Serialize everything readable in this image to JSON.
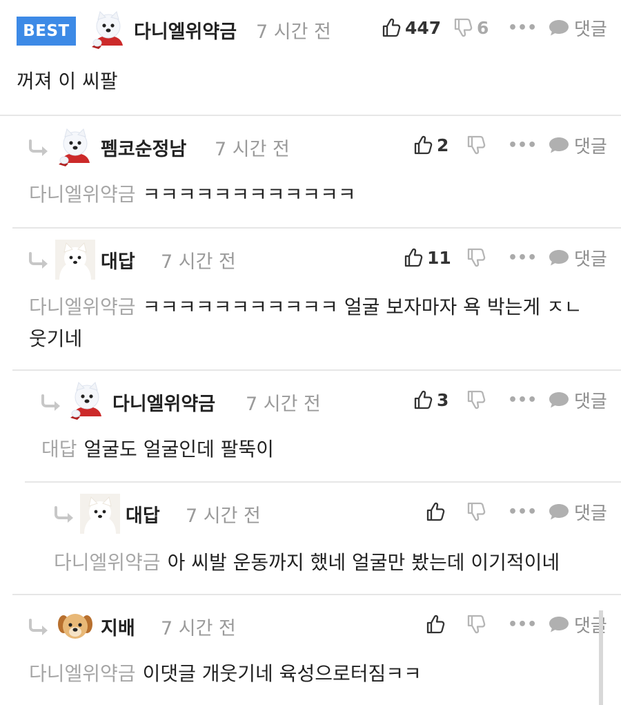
{
  "best_badge": "BEST",
  "comments": [
    {
      "user": "다니엘위약금",
      "time": "7 시간 전",
      "likes": "447",
      "dislikes": "6",
      "reply": "댓글",
      "mention": "",
      "text": "꺼져 이 씨팔",
      "avatar": "samoyed-red-scarf"
    },
    {
      "user": "펨코순정남",
      "time": "7 시간 전",
      "likes": "2",
      "dislikes": "",
      "reply": "댓글",
      "mention": "다니엘위약금",
      "text": "ㅋㅋㅋㅋㅋㅋㅋㅋㅋㅋㅋㅋ",
      "avatar": "samoyed-red-scarf"
    },
    {
      "user": "대답",
      "time": "7 시간 전",
      "likes": "11",
      "dislikes": "",
      "reply": "댓글",
      "mention": "다니엘위약금",
      "text": "ㅋㅋㅋㅋㅋㅋㅋㅋㅋㅋㅋ 얼굴 보자마자 욕 박는게 ㅈㄴ",
      "text2": "웃기네",
      "avatar": "white-puppy"
    },
    {
      "user": "다니엘위약금",
      "time": "7 시간 전",
      "likes": "3",
      "dislikes": "",
      "reply": "댓글",
      "mention": "대답",
      "text": "얼굴도 얼굴인데 팔뚝이",
      "avatar": "samoyed-red-scarf"
    },
    {
      "user": "대답",
      "time": "7 시간 전",
      "likes": "",
      "dislikes": "",
      "reply": "댓글",
      "mention": "다니엘위약금",
      "text": "아 씨발 운동까지 했네 얼굴만 봤는데 이기적이네",
      "avatar": "white-puppy"
    },
    {
      "user": "지배",
      "time": "7 시간 전",
      "likes": "",
      "dislikes": "",
      "reply": "댓글",
      "mention": "다니엘위약금",
      "text": "이댓글 개웃기네 육성으로터짐ㅋㅋ",
      "avatar": "golden-puppy"
    }
  ]
}
